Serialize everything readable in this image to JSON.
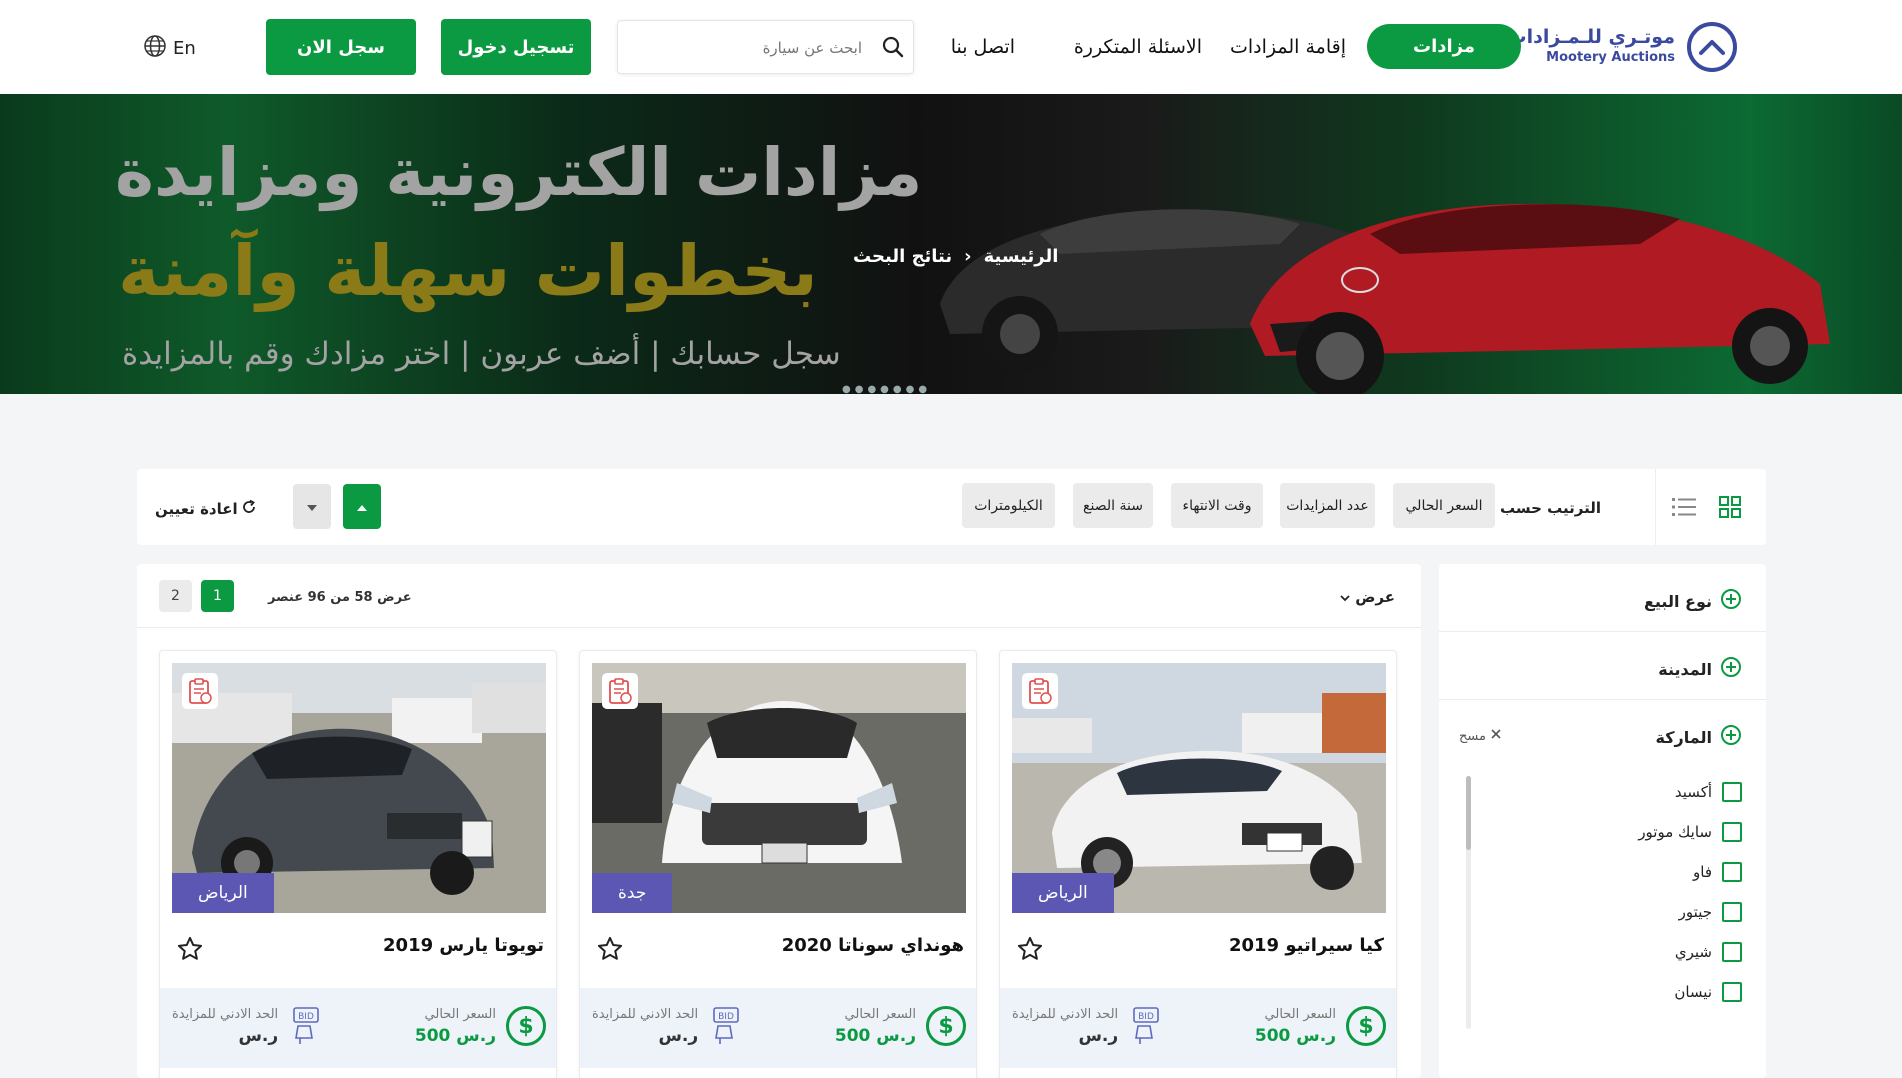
{
  "header": {
    "logo_ar": "موتـري للـمـزادات",
    "logo_en": "Mootery Auctions",
    "nav": {
      "auctions_button": "مزادات",
      "hold_auction": "إقامة المزادات",
      "faq": "الاسئلة المتكررة",
      "contact": "اتصل بنا"
    },
    "search_placeholder": "ابحث عن سيارة",
    "login_button": "تسجيل دخول",
    "register_button": "سجل الان",
    "language": "En"
  },
  "banner": {
    "headline_1": "مزادات الكترونية ومزايدة",
    "headline_2": "بخطوات سهلة وآمنة",
    "headline_3": "سجل حسابك | أضف عربون | اختر مزادك وقم بالمزايدة",
    "breadcrumb": {
      "home": "الرئيسية",
      "current": "نتائج البحث"
    }
  },
  "sortbar": {
    "sort_label": "الترتيب حسب",
    "options": [
      "السعر الحالي",
      "عدد المزايدات",
      "وقت الانتهاء",
      "سنة الصنع",
      "الكيلومترات"
    ],
    "reset_label": "اعادة تعيين"
  },
  "filters": {
    "sale_type": "نوع البيع",
    "city": "المدينة",
    "brand": "الماركة",
    "clear_label": "مسح",
    "brands": [
      "أكسيد",
      "سايك موتور",
      "فاو",
      "جيتور",
      "شيري",
      "نيسان"
    ]
  },
  "results": {
    "view_label": "عرض",
    "count_text": "عرض 58 من 96 عنصر",
    "pages": [
      "1",
      "2"
    ],
    "price_label": "السعر الحالي",
    "min_bid_label": "الحد الادني للمزايدة",
    "currency": "ر.س",
    "cards": [
      {
        "title": "كيا سيراتيو 2019",
        "city": "الرياض",
        "price": "500",
        "min_bid": ""
      },
      {
        "title": "هونداي سوناتا 2020",
        "city": "جدة",
        "price": "500",
        "min_bid": ""
      },
      {
        "title": "تويوتا يارس 2019",
        "city": "الرياض",
        "price": "500",
        "min_bid": ""
      }
    ]
  },
  "colors": {
    "brand_green": "#0b9a41",
    "logo_blue": "#3b4a9e",
    "city_tag": "#5b57b3"
  },
  "icons": [
    "logo-icon",
    "search-icon",
    "globe-icon",
    "grid-view-icon",
    "list-view-icon",
    "sort-asc-icon",
    "sort-desc-icon",
    "refresh-icon",
    "plus-circle-icon",
    "close-icon",
    "report-icon",
    "star-icon",
    "dollar-icon",
    "bid-icon",
    "chevron-down-icon"
  ]
}
